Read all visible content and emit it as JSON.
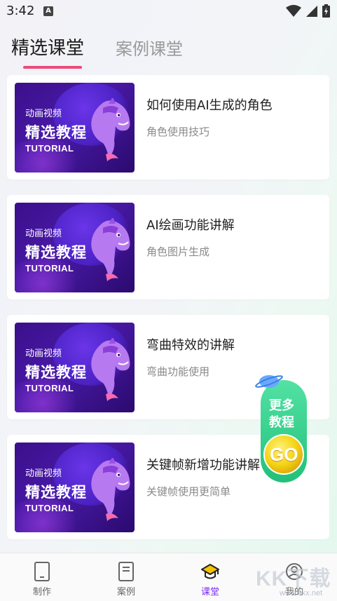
{
  "status_bar": {
    "time": "3:42",
    "notification_icon": "a-letter-icon",
    "icons": [
      "wifi-icon",
      "signal-icon",
      "battery-charging-icon"
    ]
  },
  "tabs": [
    {
      "label": "精选课堂",
      "active": true
    },
    {
      "label": "案例课堂",
      "active": false
    }
  ],
  "thumbnail": {
    "line1": "动画视频",
    "line2": "精选教程",
    "line3": "TUTORIAL"
  },
  "courses": [
    {
      "title": "如何使用AI生成的角色",
      "subtitle": "角色使用技巧"
    },
    {
      "title": "AI绘画功能讲解",
      "subtitle": "角色图片生成"
    },
    {
      "title": "弯曲特效的讲解",
      "subtitle": "弯曲功能使用"
    },
    {
      "title": "关键帧新增功能讲解",
      "subtitle": "关键帧使用更简单"
    }
  ],
  "float_button": {
    "line1": "更多",
    "line2": "教程",
    "go": "GO"
  },
  "bottom_nav": [
    {
      "label": "制作",
      "icon": "phone-icon",
      "active": false
    },
    {
      "label": "案例",
      "icon": "document-icon",
      "active": false
    },
    {
      "label": "课堂",
      "icon": "graduation-cap-icon",
      "active": true
    },
    {
      "label": "我的",
      "icon": "profile-icon",
      "active": false
    }
  ],
  "watermark": {
    "brand": "KK下载",
    "url": "www.kkx.net"
  },
  "colors": {
    "accent": "#7b2ff7",
    "tab_underline": "#ec4a7b",
    "thumbnail_bg": "#3a0f8a",
    "go_button": "#f5d313"
  }
}
